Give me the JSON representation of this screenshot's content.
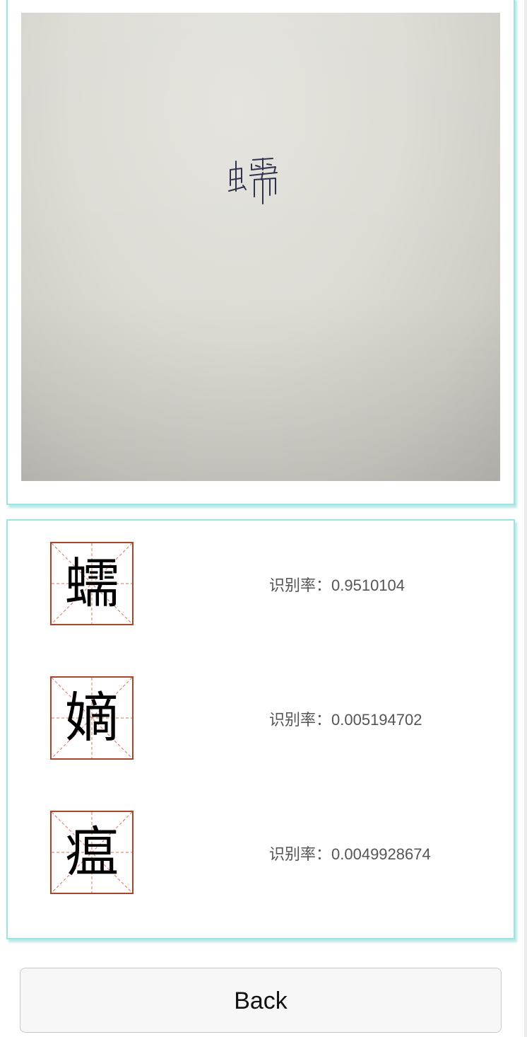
{
  "photo": {
    "handwritten_char": "蠕"
  },
  "results": [
    {
      "char": "蠕",
      "label": "识别率：",
      "value": "0.9510104"
    },
    {
      "char": "嫡",
      "label": "识别率：",
      "value": "0.005194702"
    },
    {
      "char": "瘟",
      "label": "识别率：",
      "value": "0.0049928674"
    }
  ],
  "colors": {
    "card_border": "#9fe3e1",
    "grid_border": "#a8452a",
    "grid_guides": "#d9705a"
  },
  "back_button": {
    "label": "Back"
  }
}
